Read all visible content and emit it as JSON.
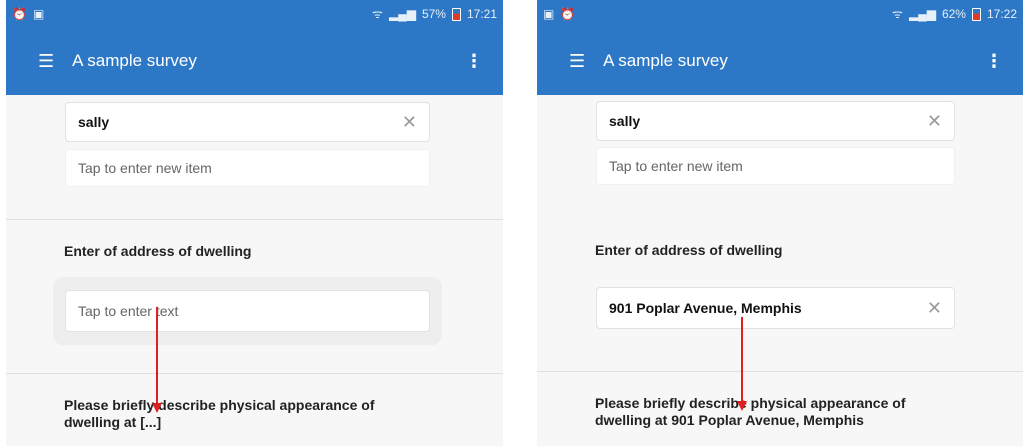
{
  "left": {
    "status_bar": {
      "left_icons": [
        "alarm-icon",
        "image-icon"
      ],
      "battery": "57%",
      "time": "17:21"
    },
    "app_bar": {
      "title": "A sample survey"
    },
    "list_items": [
      {
        "value": "sally"
      }
    ],
    "new_item_placeholder": "Tap to enter new item",
    "address_question": "Enter of address of dwelling",
    "address_placeholder": "Tap to enter text",
    "description_question": "Please briefly describe physical appearance of dwelling at [...]"
  },
  "right": {
    "status_bar": {
      "left_icons": [
        "image-icon",
        "alarm-icon"
      ],
      "battery": "62%",
      "time": "17:22"
    },
    "app_bar": {
      "title": "A sample survey"
    },
    "list_items": [
      {
        "value": "sally"
      }
    ],
    "new_item_placeholder": "Tap to enter new item",
    "address_question": "Enter of address of dwelling",
    "address_value": "901 Poplar Avenue, Memphis",
    "description_question": "Please briefly describe physical appearance of dwelling at 901 Poplar Avenue, Memphis"
  },
  "colors": {
    "app_bar": "#2c78c6",
    "arrow": "#e02020"
  },
  "icons": {
    "menu": "menu-icon",
    "more": "more-vert-icon",
    "clear": "close-icon"
  }
}
